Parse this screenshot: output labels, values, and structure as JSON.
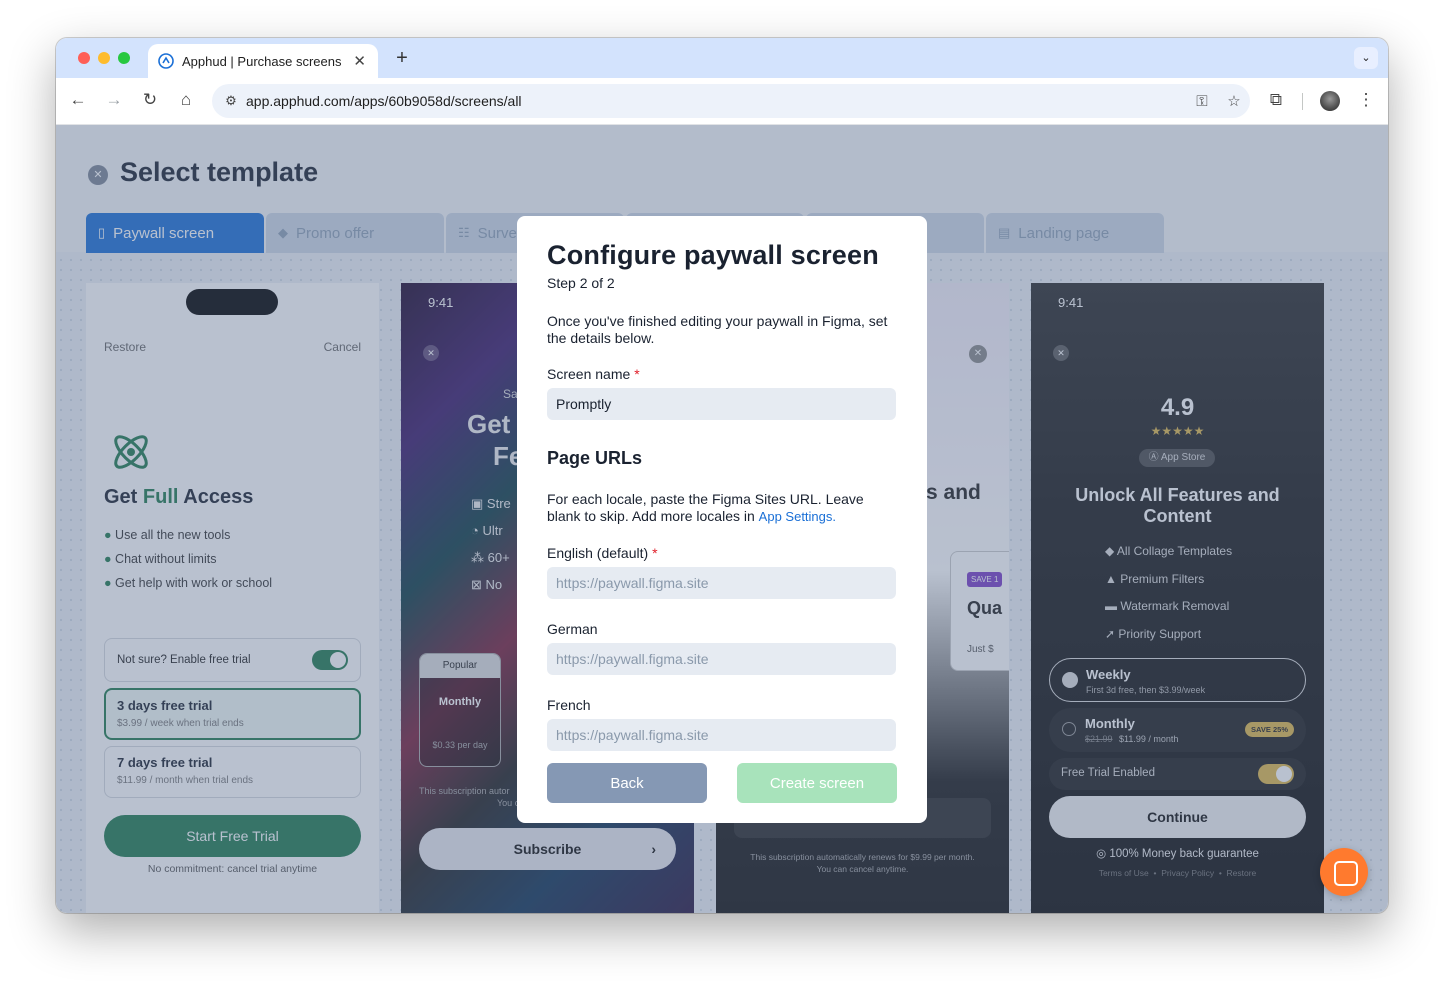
{
  "browser": {
    "tab_title": "Apphud | Purchase screens",
    "url": "app.apphud.com/apps/60b9058d/screens/all"
  },
  "page": {
    "title": "Select template",
    "tabs": [
      "Paywall screen",
      "Promo offer",
      "Surve",
      "Landing page"
    ]
  },
  "card1": {
    "restore": "Restore",
    "cancel": "Cancel",
    "headline_pre": "Get ",
    "headline_accent": "Full",
    "headline_post": " Access",
    "features": [
      "Use all the new tools",
      "Chat without limits",
      "Get help with work or school"
    ],
    "trial_toggle": "Not sure? Enable free trial",
    "plans": [
      {
        "title": "3 days free trial",
        "sub": "$3.99 / week when trial ends"
      },
      {
        "title": "7 days free trial",
        "sub": "$11.99 / month when trial ends"
      }
    ],
    "cta": "Start Free Trial",
    "footnote": "No commitment: cancel trial anytime"
  },
  "card2": {
    "time": "9:41",
    "sa": "Sa",
    "headline1": "Get",
    "headline2": "Fe",
    "features": [
      "Stre",
      "Ultr",
      "60+",
      "No"
    ],
    "popular": "Popular",
    "monthly": "Monthly",
    "per_day": "$0.33 per day",
    "fine1": "This subscription autor",
    "fine2": "You c",
    "subscribe": "Subscribe"
  },
  "card3": {
    "headline": "s and",
    "save": "SAVE 1",
    "plan": "Qua",
    "just": "Just $",
    "fine1": "This subscription automatically renews for $9.99 per month.",
    "fine2": "You can cancel anytime."
  },
  "card4": {
    "time": "9:41",
    "rating": "4.9",
    "stars": "★★★★★",
    "store": "App Store",
    "headline": "Unlock All Features and Content",
    "features": [
      "All Collage Templates",
      "Premium Filters",
      "Watermark Removal",
      "Priority Support"
    ],
    "weekly_title": "Weekly",
    "weekly_sub": "First 3d free, then $3.99/week",
    "monthly_title": "Monthly",
    "monthly_old": "$21.99",
    "monthly_sub": "$11.99 / month",
    "monthly_badge": "SAVE 25%",
    "trial": "Free Trial Enabled",
    "cta": "Continue",
    "guarantee": "100% Money back guarantee",
    "links": "Terms of Use  •  Privacy Policy  •  Restore"
  },
  "modal": {
    "title": "Configure paywall screen",
    "step": "Step 2 of 2",
    "desc": "Once you've finished editing your paywall in Figma, set the details below.",
    "screen_name_label": "Screen name",
    "screen_name_value": "Promptly",
    "urls_heading": "Page URLs",
    "urls_desc": "For each locale, paste the Figma Sites URL. Leave blank to skip. Add more locales in ",
    "urls_link": "App Settings.",
    "english_label": "English (default)",
    "german_label": "German",
    "french_label": "French",
    "url_placeholder": "https://paywall.figma.site",
    "back": "Back",
    "create": "Create screen"
  },
  "colors": {
    "accent": "#1a6fd6",
    "green": "#1f7a4f",
    "required": "#e0202a",
    "help": "#ff7a2e"
  }
}
